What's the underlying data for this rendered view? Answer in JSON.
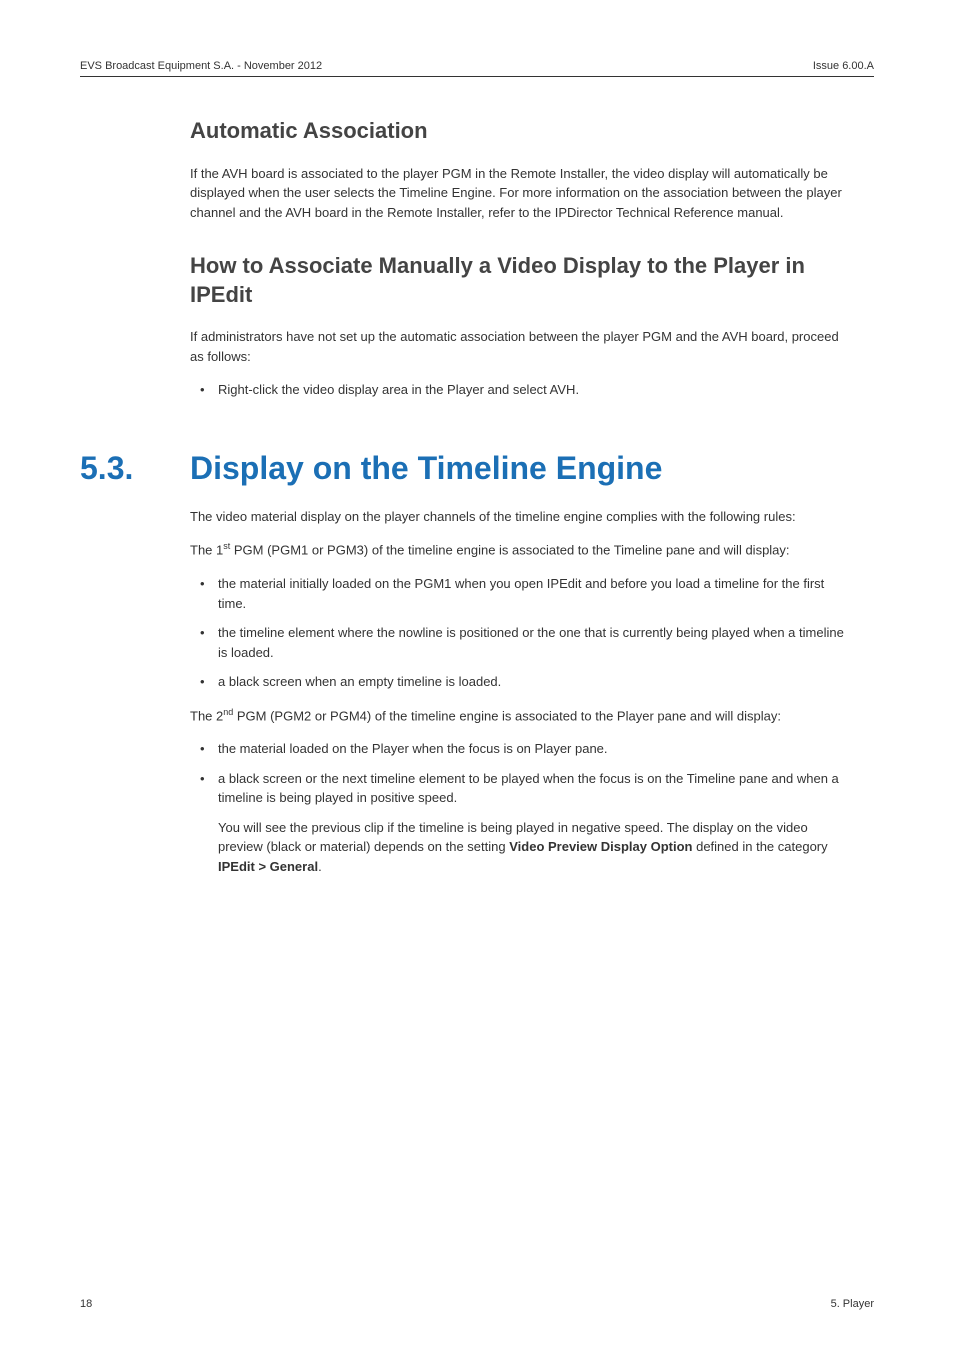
{
  "header": {
    "left": "EVS Broadcast Equipment S.A.  - November 2012",
    "right": "Issue 6.00.A"
  },
  "section1": {
    "heading": "Automatic Association",
    "para1": "If the AVH board is associated to the player PGM in the Remote Installer, the video display will automatically be displayed when the user selects the Timeline Engine. For more information on the association between the player channel and the AVH board in the Remote Installer, refer to the IPDirector Technical Reference manual."
  },
  "section2": {
    "heading": "How to Associate Manually a Video Display to the Player in IPEdit",
    "para1": "If administrators have not set up the automatic association between the player PGM and the AVH board, proceed as follows:",
    "bullet1": "Right-click the video display area in the Player and select AVH."
  },
  "section3": {
    "number": "5.3.",
    "title": "Display on the Timeline Engine",
    "para1": "The video material display on the player channels of the timeline engine complies with the following rules:",
    "para2_pre": "The 1",
    "para2_sup": "st",
    "para2_post": " PGM (PGM1 or PGM3) of the timeline engine is associated to the Timeline pane and will display:",
    "list1": {
      "item1": "the material initially loaded on the PGM1 when you open IPEdit and before you load a timeline for the first time.",
      "item2": "the timeline element where the nowline is positioned or the one that is currently being played when a timeline is loaded.",
      "item3": "a black screen when an empty timeline is loaded."
    },
    "para3_pre": "The 2",
    "para3_sup": "nd",
    "para3_post": " PGM (PGM2 or PGM4) of the timeline engine is associated to the Player pane and will display:",
    "list2": {
      "item1": "the material loaded on the Player when the focus is on Player pane.",
      "item2_p1": "a black screen or the next timeline element to be played when the focus is on the Timeline pane and when a timeline is being played in positive speed.",
      "item2_p2a": "You will see the previous clip if the timeline is being played in negative speed. The display on the video preview (black or material) depends on the setting ",
      "item2_p2b": "Video Preview Display Option",
      "item2_p2c": " defined in the category ",
      "item2_p2d": "IPEdit > General",
      "item2_p2e": "."
    }
  },
  "footer": {
    "left": "18",
    "right": "5. Player"
  }
}
